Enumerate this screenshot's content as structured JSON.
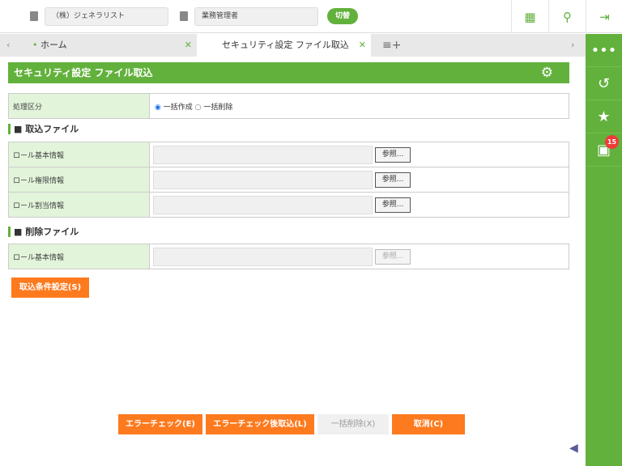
{
  "header": {
    "company": "（株）ジェネラリスト",
    "role": "業務管理者",
    "switch_label": "切替"
  },
  "tabs": [
    {
      "label": "ホーム"
    },
    {
      "label": "セキュリティ設定 ファイル取込"
    }
  ],
  "page": {
    "title": "セキュリティ設定 ファイル取込"
  },
  "process": {
    "label": "処理区分",
    "options": [
      "一括作成",
      "一括削除"
    ],
    "selected": "一括作成"
  },
  "import_section": {
    "title": "■ 取込ファイル",
    "rows": [
      {
        "label": "ロール基本情報",
        "button": "参照..."
      },
      {
        "label": "ロール権限情報",
        "button": "参照..."
      },
      {
        "label": "ロール割当情報",
        "button": "参照..."
      }
    ]
  },
  "delete_section": {
    "title": "■ 削除ファイル",
    "rows": [
      {
        "label": "ロール基本情報",
        "button": "参照..."
      }
    ]
  },
  "condition_button": "取込条件設定(S)",
  "footer": {
    "error_check": "エラーチェック(E)",
    "check_import": "エラーチェック後取込(L)",
    "bulk_delete": "一括削除(X)",
    "cancel": "取消(C)"
  },
  "sidebar": {
    "notification_count": "15"
  },
  "colors": {
    "accent": "#62b13c",
    "orange": "#fe7a1e"
  }
}
